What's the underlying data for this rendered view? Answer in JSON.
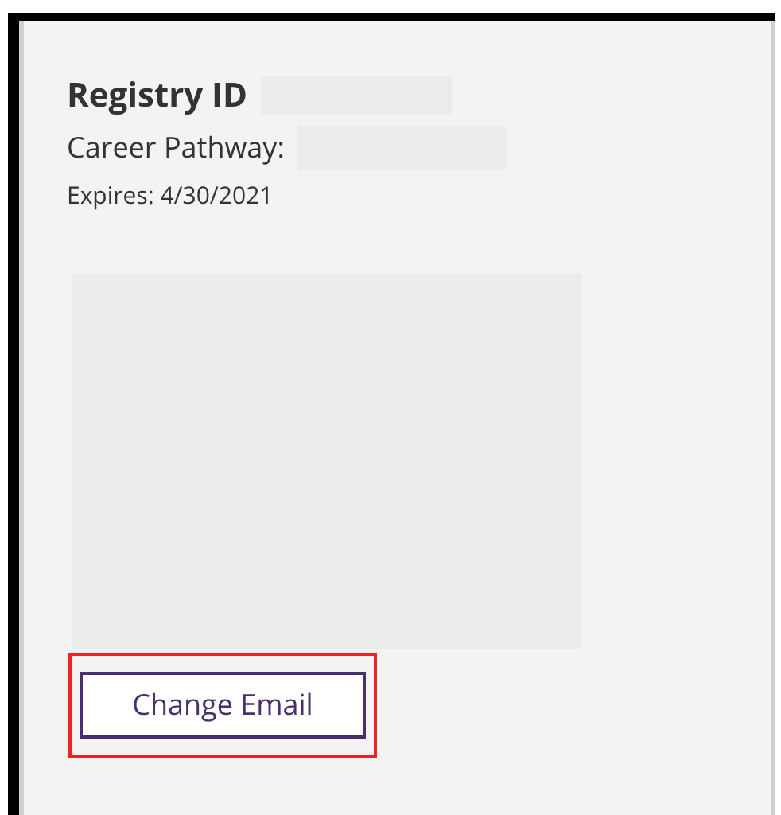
{
  "card": {
    "registry_label": "Registry ID",
    "pathway_label": "Career Pathway:",
    "expires": "Expires: 4/30/2021",
    "button": {
      "label": "Change Email",
      "highlighted": true
    }
  }
}
